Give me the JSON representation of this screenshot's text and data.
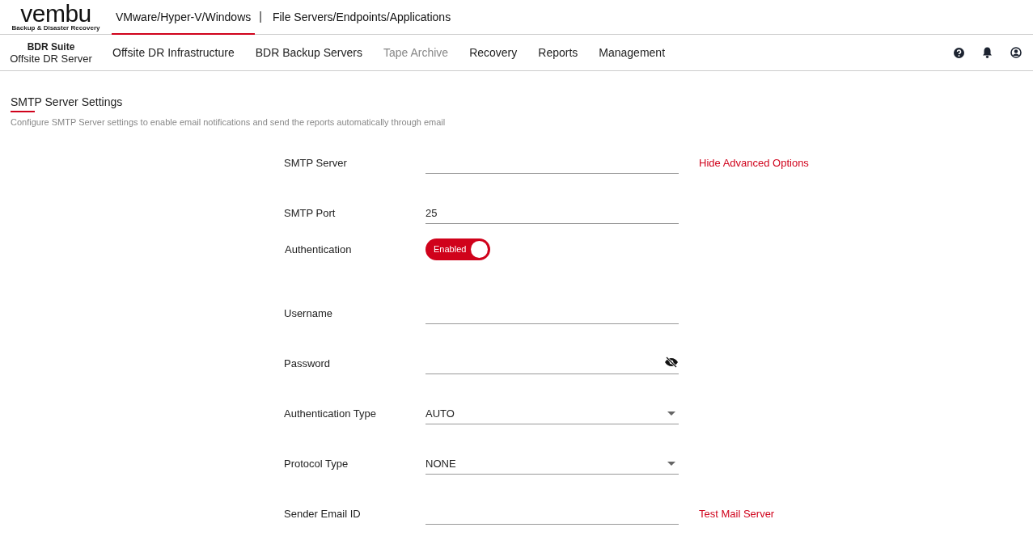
{
  "logo": {
    "wordmark": "vembu",
    "tagline": "Backup & Disaster Recovery"
  },
  "top_tabs": [
    {
      "label": "VMware/Hyper-V/Windows",
      "selected": true
    },
    {
      "label": "File Servers/Endpoints/Applications",
      "selected": false
    }
  ],
  "top_separator": "|",
  "product": {
    "suite": "BDR Suite",
    "name": "Offsite DR Server"
  },
  "nav": [
    {
      "label": "Offsite DR Infrastructure",
      "disabled": false
    },
    {
      "label": "BDR Backup Servers",
      "disabled": false
    },
    {
      "label": "Tape Archive",
      "disabled": true
    },
    {
      "label": "Recovery",
      "disabled": false
    },
    {
      "label": "Reports",
      "disabled": false
    },
    {
      "label": "Management",
      "disabled": false
    }
  ],
  "section": {
    "title": "SMTP Server Settings",
    "description": "Configure SMTP Server settings to enable email notifications and send the reports automatically through email"
  },
  "fields": [
    {
      "kind": "text",
      "label": "SMTP Server",
      "link": "Hide Advanced Options"
    },
    {
      "kind": "text",
      "label": "SMTP Port",
      "value": "25"
    },
    {
      "kind": "toggle",
      "label": "Authentication",
      "on": true,
      "state_label": "Enabled"
    },
    {
      "kind": "text",
      "label": "Username"
    },
    {
      "kind": "password",
      "label": "Password"
    },
    {
      "kind": "select",
      "label": "Authentication Type",
      "value": "AUTO"
    },
    {
      "kind": "select",
      "label": "Protocol Type",
      "value": "NONE"
    },
    {
      "kind": "text",
      "label": "Sender Email ID",
      "link": "Test Mail Server"
    }
  ]
}
